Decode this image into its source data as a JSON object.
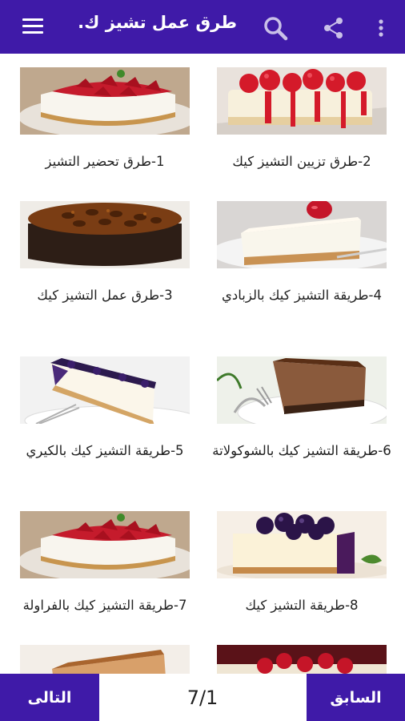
{
  "appbar": {
    "title": "طرق عمل تشيز ك...",
    "menu_icon": "hamburger-menu-icon",
    "search_icon": "search-icon",
    "share_icon": "share-icon",
    "more_icon": "more-vert-icon",
    "color": "#3f1aa8"
  },
  "items": [
    {
      "caption": "2-طرق تزيين التشيز كيك",
      "image": "cherry-cheesecake-slice"
    },
    {
      "caption": "1-طرق تحضير التشيز",
      "image": "strawberry-cheesecake"
    },
    {
      "caption": "4-طريقة التشيز كيك بالزبادي",
      "image": "strawberry-cheesecake-slice"
    },
    {
      "caption": "3-طرق عمل التشيز كيك",
      "image": "pecan-cheesecake"
    },
    {
      "caption": "6-طريقة التشيز كيك بالشوكولاتة",
      "image": "chocolate-cheesecake-slice"
    },
    {
      "caption": "5-طريقة التشيز كيك بالكيري",
      "image": "blueberry-cheesecake-slice"
    },
    {
      "caption": "8-طريقة التشيز كيك",
      "image": "blueberry-cheesecake-piece"
    },
    {
      "caption": "7-طريقة التشيز كيك بالفراولة",
      "image": "strawberry-cheesecake"
    },
    {
      "caption": "",
      "image": "raspberry-cheesecake"
    },
    {
      "caption": "",
      "image": "caramel-cheesecake-slice"
    }
  ],
  "bottombar": {
    "prev_label": "السابق",
    "next_label": "التالى",
    "page": "7/1"
  }
}
